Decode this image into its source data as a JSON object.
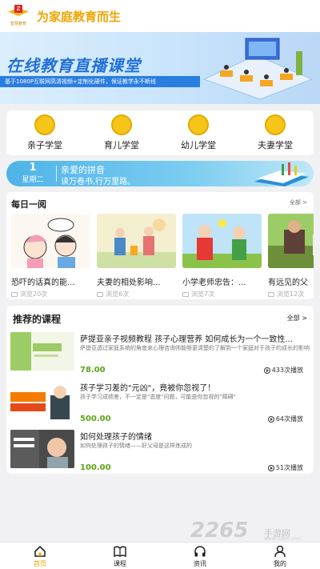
{
  "header": {
    "slogan": "为家庭教育而生"
  },
  "banner": {
    "title": "在线教育直播课堂",
    "subtitle": "基于1080P互联网高清视频+定制化硬件，保证教学永不断线"
  },
  "categories": [
    {
      "label": "亲子学堂",
      "icon": "family-icon"
    },
    {
      "label": "育儿学堂",
      "icon": "lightbulb-icon"
    },
    {
      "label": "幼儿学堂",
      "icon": "atom-icon"
    },
    {
      "label": "夫妻学堂",
      "icon": "couple-icon"
    }
  ],
  "pinyin": {
    "day": "1",
    "weekday": "星期二",
    "title": "亲爱的拼音",
    "subtitle": "读万卷书,行万里路。"
  },
  "daily": {
    "title": "每日一阅",
    "more": "全部 >",
    "items": [
      {
        "title": "恐吓的话真的能...",
        "views": "浏览20次"
      },
      {
        "title": "夫妻的相处影响...",
        "views": "浏览6次"
      },
      {
        "title": "小学老师忠告：...",
        "views": "浏览7次"
      },
      {
        "title": "有远见的父",
        "views": "浏览12次"
      }
    ]
  },
  "recommended": {
    "title": "推荐的课程",
    "more": "全部 >",
    "courses": [
      {
        "title": "萨提亚亲子视频教程 孩子心理营养 如何成长为一个一致性...",
        "desc": "萨提亚透过家庭系统的角度来心理咨询师能够更清楚的了解到一个家庭对于孩子的成长的影响",
        "price": "78.00",
        "plays": "433次播放"
      },
      {
        "title": "孩子学习差的\"元凶\"，竟被你忽视了！",
        "desc": "孩子学习成绩差，不一定是\"态度\"问题，可能是你忽视的\"障碍\"",
        "price": "500.00",
        "plays": "64次播放"
      },
      {
        "title": "如何处理孩子的情绪",
        "desc": "如何处理孩子的情绪——好父母是这样炼成的",
        "price": "100.00",
        "plays": "51次播放"
      }
    ]
  },
  "nav": [
    {
      "label": "首页",
      "active": true
    },
    {
      "label": "课程"
    },
    {
      "label": "资讯"
    },
    {
      "label": "我的"
    }
  ],
  "watermark": {
    "number": "2265",
    "text": "手游网",
    "url": "www.2265.com"
  },
  "colors": {
    "accent": "#f0a500",
    "price": "#5aa516",
    "brand_blue": "#2270d9"
  }
}
